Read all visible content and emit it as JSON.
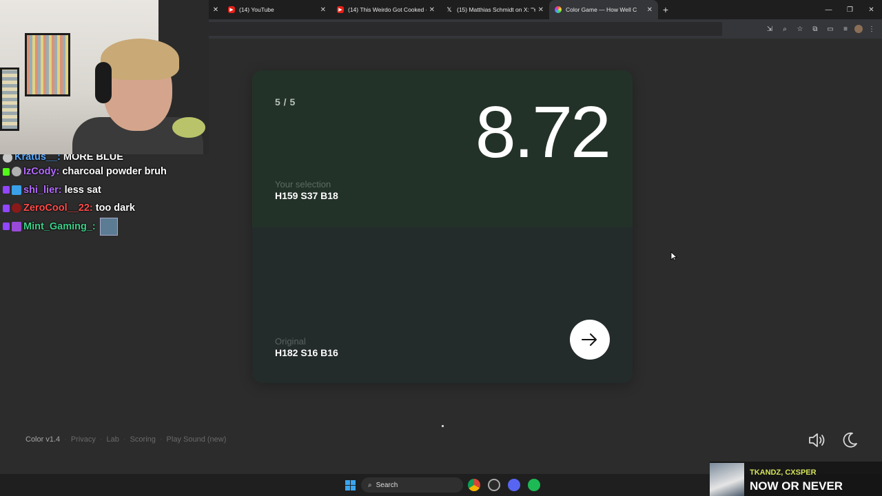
{
  "browser": {
    "tabs": [
      {
        "title": "(14) YouTube",
        "favicon": "youtube-icon",
        "active": false
      },
      {
        "title": "(14) This Weirdo Got Cooked -",
        "favicon": "youtube-icon",
        "active": false
      },
      {
        "title": "(15) Matthias Schmidt on X: \"Yo",
        "favicon": "x-icon",
        "active": false
      },
      {
        "title": "Color Game — How Well C",
        "favicon": "color-game-icon",
        "active": true
      }
    ]
  },
  "game": {
    "round": "5 / 5",
    "score": "8.72",
    "selection_label": "Your selection",
    "selection_value": "H159 S37 B18",
    "original_label": "Original",
    "original_value": "H182 S16 B16",
    "selection_color": "#233228",
    "original_color": "#242b2b"
  },
  "footer": {
    "version": "Color v1.4",
    "links": [
      "Privacy",
      "Lab",
      "Scoring",
      "Play Sound (new)"
    ]
  },
  "chat": [
    {
      "user": "Kratus__:",
      "text": "MORE BLUE",
      "color": "#5aa9ff",
      "badge": "twitch"
    },
    {
      "user": "IzCody:",
      "text": "charcoal powder bruh",
      "color": "#b36bff",
      "badge": "kick"
    },
    {
      "user": "shi_lier:",
      "text": "less sat",
      "color": "#b36bff",
      "badge": "twitch"
    },
    {
      "user": "ZeroCool__22:",
      "text": "too dark",
      "color": "#ff4b4b",
      "badge": "twitch"
    },
    {
      "user": "Mint_Gaming_:",
      "text": "",
      "color": "#3cd08a",
      "badge": "twitch"
    }
  ],
  "taskbar": {
    "search_label": "Search"
  },
  "now_playing": {
    "artist": "TKANDZ, CXSPER",
    "title": "NOW OR NEVER"
  }
}
